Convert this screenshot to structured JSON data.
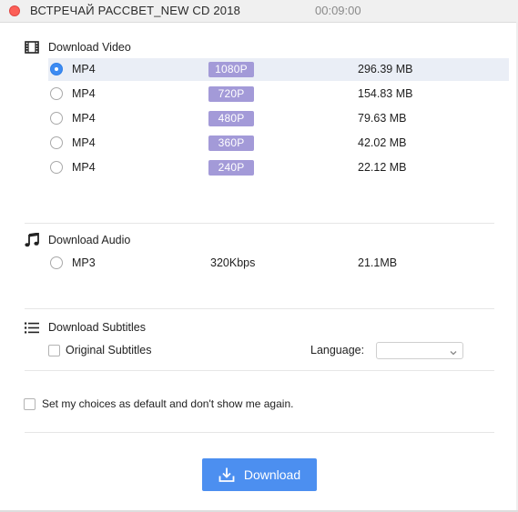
{
  "window": {
    "title": "ВСТРЕЧАЙ РАССВЕТ_NEW CD 2018",
    "duration": "00:09:00"
  },
  "video": {
    "heading": "Download Video",
    "icon": "film-icon",
    "options": [
      {
        "format": "MP4",
        "quality": "1080P",
        "size": "296.39 MB",
        "selected": true
      },
      {
        "format": "MP4",
        "quality": "720P",
        "size": "154.83 MB",
        "selected": false
      },
      {
        "format": "MP4",
        "quality": "480P",
        "size": "79.63 MB",
        "selected": false
      },
      {
        "format": "MP4",
        "quality": "360P",
        "size": "42.02 MB",
        "selected": false
      },
      {
        "format": "MP4",
        "quality": "240P",
        "size": "22.12 MB",
        "selected": false
      }
    ]
  },
  "audio": {
    "heading": "Download Audio",
    "icon": "music-note-icon",
    "options": [
      {
        "format": "MP3",
        "quality": "320Kbps",
        "size": "21.1MB",
        "selected": false
      }
    ]
  },
  "subtitles": {
    "heading": "Download Subtitles",
    "icon": "list-icon",
    "original_label": "Original Subtitles",
    "language_label": "Language:",
    "language_value": ""
  },
  "default_choice_label": "Set my choices as default and don't show me again.",
  "download_button": {
    "label": "Download",
    "icon": "download-icon"
  },
  "colors": {
    "accent": "#4c8ff0",
    "badge": "#a39ad8",
    "selected_row": "#eaeef6",
    "close": "#fc5f57"
  }
}
